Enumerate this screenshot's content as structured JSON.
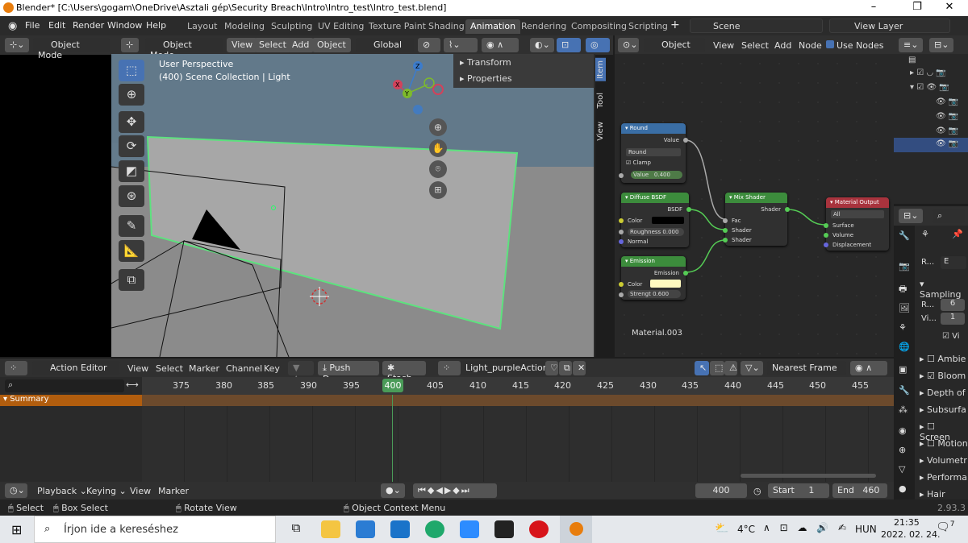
{
  "window": {
    "title": "Blender* [C:\\Users\\gogam\\OneDrive\\Asztali gép\\Security Breach\\Intro\\Intro_test\\Intro_test.blend]",
    "minimize": "–",
    "maximize": "❐",
    "close": "✕"
  },
  "menu": {
    "file": "File",
    "edit": "Edit",
    "render": "Render",
    "window": "Window",
    "help": "Help"
  },
  "workspaces": [
    "Layout",
    "Modeling",
    "Sculpting",
    "UV Editing",
    "Texture Paint",
    "Shading",
    "Animation",
    "Rendering",
    "Compositing",
    "Scripting"
  ],
  "active_workspace": "Animation",
  "scene": {
    "name": "Scene",
    "view_layer": "View Layer"
  },
  "viewport_header": {
    "mode": "Object Mode",
    "mode2": "Object Mode",
    "view": "View",
    "select": "Select",
    "add": "Add",
    "object": "Object",
    "transform": "Global"
  },
  "viewport": {
    "perspective": "User Perspective",
    "collection": "(400) Scene Collection | Light",
    "n_panel": {
      "transform": "Transform",
      "properties": "Properties"
    },
    "side_tabs": [
      "Item",
      "Tool",
      "View"
    ]
  },
  "node_header": {
    "type": "Object",
    "view": "View",
    "select": "Select",
    "add": "Add",
    "node": "Node",
    "use_nodes": "Use Nodes"
  },
  "nodes": {
    "round": {
      "title": "Round",
      "output": "Value",
      "op": "Round",
      "clamp": "Clamp",
      "value_label": "Value",
      "value": "0.400"
    },
    "diffuse": {
      "title": "Diffuse BSDF",
      "output": "BSDF",
      "color": "Color",
      "roughness": "Roughness 0.000",
      "normal": "Normal"
    },
    "emission": {
      "title": "Emission",
      "output": "Emission",
      "color": "Color",
      "strength": "Strengt  0.600"
    },
    "mix": {
      "title": "Mix Shader",
      "output": "Shader",
      "fac": "Fac",
      "shader1": "Shader",
      "shader2": "Shader"
    },
    "output": {
      "title": "Material Output",
      "target": "All",
      "surface": "Surface",
      "volume": "Volume",
      "displacement": "Displacement"
    },
    "material_name": "Material.003"
  },
  "action_editor": {
    "mode": "Action Editor",
    "view": "View",
    "select": "Select",
    "marker": "Marker",
    "channel": "Channel",
    "key": "Key",
    "push_down": "Push Down",
    "stash": "Stash",
    "action": "Light_purpleAction",
    "snap": "Nearest Frame",
    "summary": "Summary",
    "frames": [
      "375",
      "380",
      "385",
      "390",
      "395",
      "400",
      "405",
      "410",
      "415",
      "420",
      "425",
      "430",
      "435",
      "440",
      "445",
      "450",
      "455"
    ],
    "current_frame": "400"
  },
  "timeline": {
    "playback": "Playback",
    "keying": "Keying",
    "view": "View",
    "marker": "Marker",
    "frame": "400",
    "start_label": "Start",
    "start": "1",
    "end_label": "End",
    "end": "460"
  },
  "properties": {
    "render_engine_short": "R...",
    "engine_value": "E",
    "sampling": "Sampling",
    "render_label": "R...",
    "render_value": "6",
    "viewport_label": "Vi...",
    "viewport_value": "1",
    "vi_check": "Vi",
    "sections": [
      "Ambie",
      "Bloom",
      "Depth of",
      "Subsurfa",
      "Screen",
      "Motion",
      "Volumetr",
      "Performa",
      "Hair"
    ]
  },
  "status": {
    "select": "Select",
    "box_select": "Box Select",
    "rotate": "Rotate View",
    "context": "Object Context Menu",
    "version": "2.93.3"
  },
  "taskbar": {
    "search": "Írjon ide a kereséshez",
    "weather": "4°C",
    "lang": "HUN",
    "time": "21:35",
    "date": "2022. 02. 24.",
    "notif": "7"
  }
}
